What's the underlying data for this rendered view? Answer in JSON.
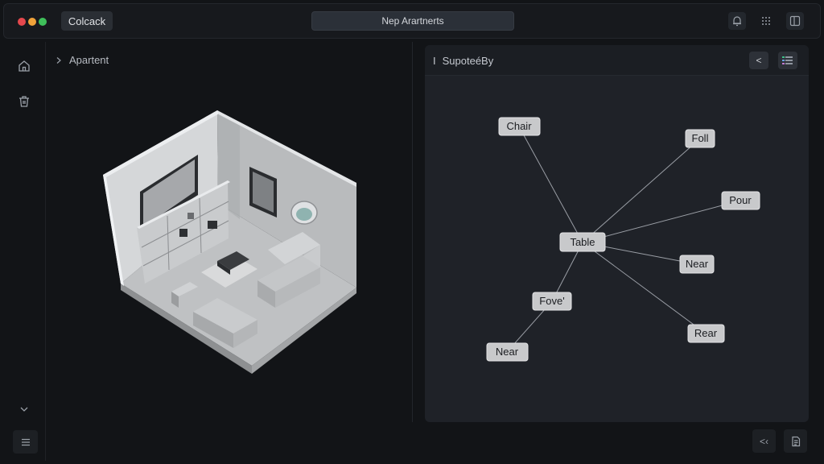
{
  "titlebar": {
    "app_button": "Colcack",
    "center_title": "Nep Arartnerts",
    "window_controls": [
      {
        "name": "close",
        "color": "#e5484d"
      },
      {
        "name": "minimize",
        "color": "#f0a23a"
      },
      {
        "name": "maximize",
        "color": "#3fbf5a"
      }
    ],
    "icons": [
      "notification-icon",
      "grid-icon",
      "panel-icon"
    ]
  },
  "left_rail": {
    "icons": [
      "home-icon",
      "trash-icon",
      "chevron-down-icon",
      "menu-icon"
    ]
  },
  "left_panel": {
    "breadcrumb": "Apartent",
    "breadcrumb_icon": "chevron-right-icon"
  },
  "right_panel": {
    "title_prefix": "I",
    "title": "SupoteéBy",
    "back_button": "<",
    "view_icon": "list-icon"
  },
  "graph": {
    "center": "Table",
    "nodes": [
      "Chair",
      "Foll",
      "Pour",
      "Near",
      "Rear",
      "Fove'",
      "Near"
    ]
  },
  "bottom": {
    "collapse_button": "<‹",
    "doc_icon": "document-icon"
  },
  "colors": {
    "background": "#121417",
    "panel": "#1f2228",
    "node_fill": "#c8c9cb",
    "edge": "#9a9ea5"
  }
}
